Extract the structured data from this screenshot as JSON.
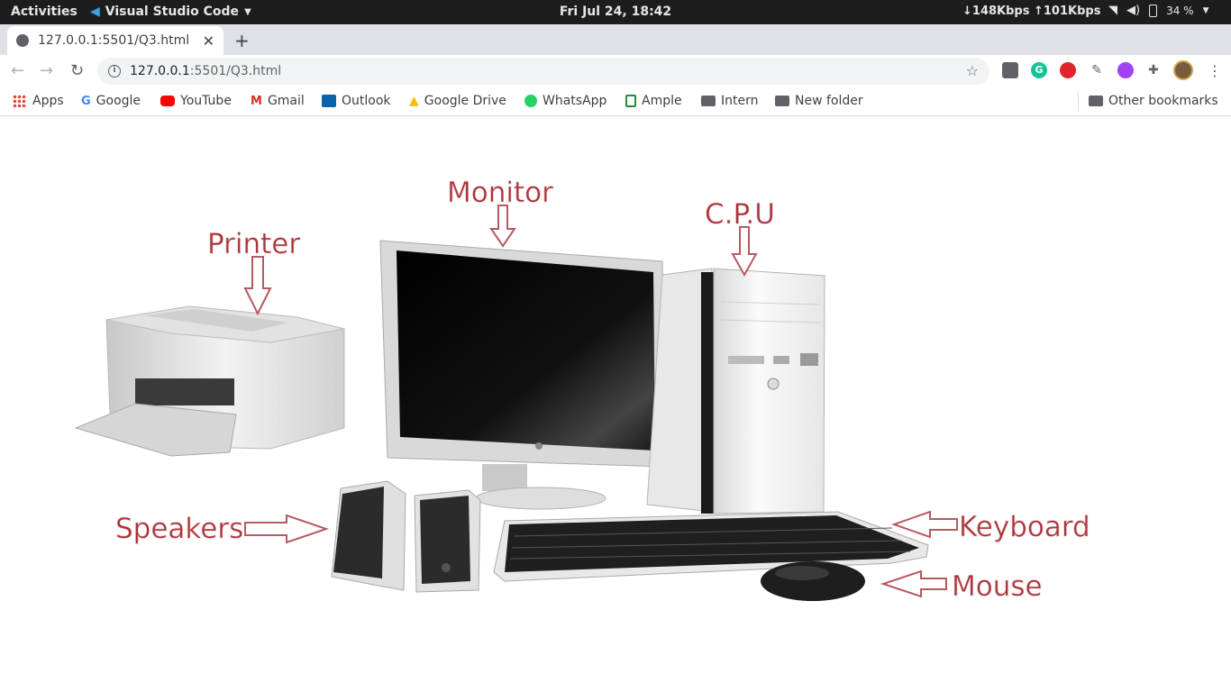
{
  "topbar": {
    "activities": "Activities",
    "app_name": "Visual Studio Code",
    "clock": "Fri Jul 24, 18:42",
    "network": "↓148Kbps ↑101Kbps",
    "battery": "34 %"
  },
  "tab": {
    "title": "127.0.0.1:5501/Q3.html"
  },
  "omnibox": {
    "host": "127.0.0.1",
    "path": ":5501/Q3.html"
  },
  "bookmarks": {
    "items": [
      "Apps",
      "Google",
      "YouTube",
      "Gmail",
      "Outlook",
      "Google Drive",
      "WhatsApp",
      "Ample",
      "Intern",
      "New folder"
    ],
    "other": "Other bookmarks"
  },
  "figure": {
    "labels": {
      "printer": "Printer",
      "monitor": "Monitor",
      "cpu": "C.P.U",
      "speakers": "Speakers",
      "keyboard": "Keyboard",
      "mouse": "Mouse"
    }
  },
  "colors": {
    "label": "#a8333a",
    "topbar": "#1d1d1d",
    "tabstrip": "#dee1e6"
  }
}
